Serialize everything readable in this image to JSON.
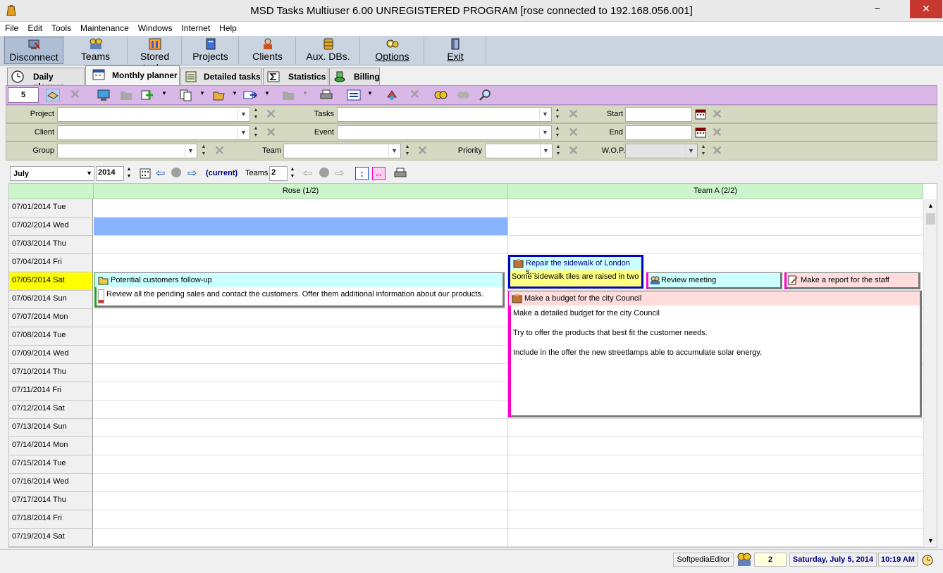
{
  "window": {
    "title": "MSD Tasks Multiuser 6.00 UNREGISTERED PROGRAM [rose connected to 192.168.056.001]",
    "minimize": "−",
    "close": "✕"
  },
  "menu": [
    "File",
    "Edit",
    "Tools",
    "Maintenance",
    "Windows",
    "Internet",
    "Help"
  ],
  "toolbar": {
    "disconnect": "Disconnect",
    "teams": "Teams",
    "stored_tasks": "Stored tasks",
    "projects": "Projects",
    "clients": "Clients",
    "aux_dbs": "Aux. DBs.",
    "options": "Options",
    "exit": "Exit"
  },
  "tabs": {
    "daily": "Daily planner",
    "monthly": "Monthly planner",
    "detailed": "Detailed tasks",
    "statistics": "Statistics",
    "billing": "Billing"
  },
  "purple_bar": {
    "value_box": "5"
  },
  "filters": {
    "project_label": "Project",
    "client_label": "Client",
    "group_label": "Group",
    "tasks_label": "Tasks",
    "event_label": "Event",
    "team_label": "Team",
    "priority_label": "Priority",
    "start_label": "Start",
    "end_label": "End",
    "wop_label": "W.O.P."
  },
  "nav": {
    "month": "July",
    "year": "2014",
    "current": "(current)",
    "teams_label": "Teams",
    "teams_value": "2"
  },
  "grid": {
    "col1_header": "Rose  (1/2)",
    "col2_header": "Team A  (2/2)",
    "dates": [
      "07/01/2014 Tue",
      "07/02/2014 Wed",
      "07/03/2014 Thu",
      "07/04/2014 Fri",
      "07/05/2014 Sat",
      "07/06/2014 Sun",
      "07/07/2014 Mon",
      "07/08/2014 Tue",
      "07/09/2014 Wed",
      "07/10/2014 Thu",
      "07/11/2014 Fri",
      "07/12/2014 Sat",
      "07/13/2014 Sun",
      "07/14/2014 Mon",
      "07/15/2014 Tue",
      "07/16/2014 Wed",
      "07/17/2014 Thu",
      "07/18/2014 Fri",
      "07/19/2014 Sat"
    ],
    "highlighted_date_index": 4
  },
  "tasks": {
    "followup_title": "Potential customers follow-up",
    "followup_body": "Review all the pending sales and contact the customers. Offer them additional information about our products.",
    "sidewalk_title": "Repair the sidewalk of London s...",
    "sidewalk_body": "Some sidewalk tiles are raised in two",
    "review_title": "Review meeting",
    "report_title": "Make a report for the staff",
    "budget_title": "Make a budget for the city Council",
    "budget_line1": "Make a detailed budget for the city Council",
    "budget_line2": "Try to offer the products that best fit the customer needs.",
    "budget_line3": "Include in the offer the new streetlamps able to accumulate solar energy."
  },
  "status": {
    "user": "SoftpediaEditor",
    "count": "2",
    "date": "Saturday, July 5, 2014",
    "time": "10:19 AM"
  },
  "colors": {
    "menu_toolbar": "#c9d4e0",
    "purple_toolbar": "#d9b8e8",
    "filter_rows": "#d5d9c2",
    "grid_header": "#ccf5cc",
    "highlight_date": "#ffff00",
    "selected_cell": "#88b4ff",
    "followup_task": "#ccffff",
    "sidewalk_task_border": "#0000cc",
    "sidewalk_body": "#ffff80",
    "review_task": "#ccffff",
    "report_task": "#ffdddd",
    "budget_task": "#ffdddd",
    "budget_border": "#ff00cc",
    "status_text_blue": "#000080"
  }
}
